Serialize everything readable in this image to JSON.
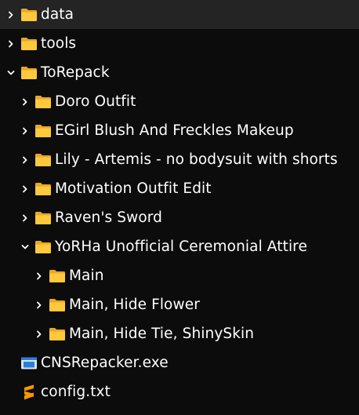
{
  "tree": {
    "items": [
      {
        "label": "data",
        "icon": "folder-icon",
        "chevron": "collapsed",
        "depth": 0,
        "selected": true
      },
      {
        "label": "tools",
        "icon": "folder-icon",
        "chevron": "collapsed",
        "depth": 0
      },
      {
        "label": "ToRepack",
        "icon": "folder-icon",
        "chevron": "expanded",
        "depth": 0
      },
      {
        "label": "Doro Outfit",
        "icon": "folder-icon",
        "chevron": "collapsed",
        "depth": 1
      },
      {
        "label": "EGirl Blush And Freckles Makeup",
        "icon": "folder-icon",
        "chevron": "collapsed",
        "depth": 1
      },
      {
        "label": "Lily - Artemis - no bodysuit with shorts",
        "icon": "folder-icon",
        "chevron": "collapsed",
        "depth": 1
      },
      {
        "label": "Motivation Outfit Edit",
        "icon": "folder-icon",
        "chevron": "collapsed",
        "depth": 1
      },
      {
        "label": "Raven's Sword",
        "icon": "folder-icon",
        "chevron": "collapsed",
        "depth": 1
      },
      {
        "label": "YoRHa Unofficial Ceremonial Attire",
        "icon": "folder-icon",
        "chevron": "expanded",
        "depth": 1
      },
      {
        "label": "Main",
        "icon": "folder-icon",
        "chevron": "collapsed",
        "depth": 2
      },
      {
        "label": "Main, Hide Flower",
        "icon": "folder-icon",
        "chevron": "collapsed",
        "depth": 2
      },
      {
        "label": "Main, Hide Tie, ShinySkin",
        "icon": "folder-icon",
        "chevron": "collapsed",
        "depth": 2
      },
      {
        "label": "CNSRepacker.exe",
        "icon": "exe-icon",
        "chevron": "none",
        "depth": 0
      },
      {
        "label": "config.txt",
        "icon": "sublime-text-icon",
        "chevron": "none",
        "depth": 0
      }
    ]
  },
  "colors": {
    "background": "#0c0c0c",
    "selected_row": "#242424",
    "folder": "#ffc83d",
    "folder_dark": "#e8a825",
    "exe_blue": "#2c7fd6",
    "sublime_orange": "#ff9800",
    "text": "#ffffff"
  }
}
